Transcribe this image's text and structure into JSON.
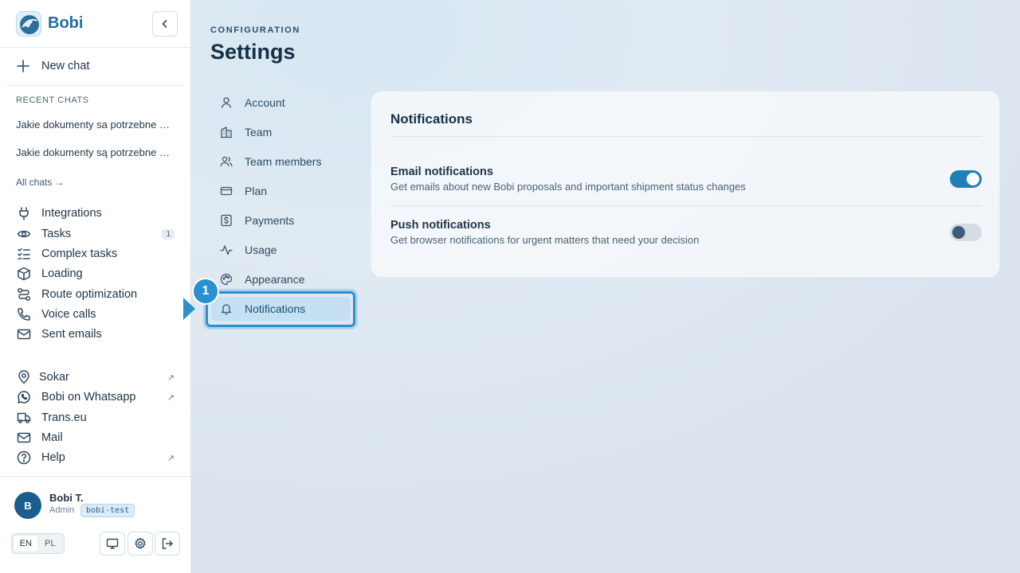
{
  "brand": {
    "name": "Bobi"
  },
  "sidebar": {
    "new_chat": "New chat",
    "recent_heading": "RECENT CHATS",
    "recent_chats": [
      "Jakie dokumenty sa potrzebne do przewozu",
      "Jakie dokumenty są potrzebne do przewozu"
    ],
    "all_chats": "All chats →",
    "nav": [
      {
        "label": "Integrations",
        "icon": "plug-icon"
      },
      {
        "label": "Tasks",
        "icon": "eye-icon",
        "badge": "1"
      },
      {
        "label": "Complex tasks",
        "icon": "checklist-icon"
      },
      {
        "label": "Loading",
        "icon": "box-icon"
      },
      {
        "label": "Route optimization",
        "icon": "route-icon"
      },
      {
        "label": "Voice calls",
        "icon": "phone-icon"
      },
      {
        "label": "Sent emails",
        "icon": "mail-icon"
      }
    ],
    "external": [
      {
        "label": "Sokar",
        "icon": "pin-icon",
        "ext": "↗"
      },
      {
        "label": "Bobi on Whatsapp",
        "icon": "whatsapp-icon",
        "ext": "↗"
      },
      {
        "label": "Trans.eu",
        "icon": "truck-icon"
      },
      {
        "label": "Mail",
        "icon": "mail-icon"
      },
      {
        "label": "Help",
        "icon": "help-icon",
        "ext": "↗"
      }
    ],
    "user": {
      "initial": "B",
      "name": "Bobi T.",
      "role": "Admin",
      "org": "bobi-test"
    },
    "languages": [
      "EN",
      "PL"
    ],
    "active_language": "EN"
  },
  "settings": {
    "kicker": "CONFIGURATION",
    "title": "Settings",
    "nav": [
      {
        "label": "Account",
        "icon": "user-icon"
      },
      {
        "label": "Team",
        "icon": "building-icon"
      },
      {
        "label": "Team members",
        "icon": "users-icon"
      },
      {
        "label": "Plan",
        "icon": "credit-card-icon"
      },
      {
        "label": "Payments",
        "icon": "dollar-icon"
      },
      {
        "label": "Usage",
        "icon": "activity-icon"
      },
      {
        "label": "Appearance",
        "icon": "palette-icon"
      },
      {
        "label": "Notifications",
        "icon": "bell-icon",
        "active": true
      }
    ],
    "step_marker": "1"
  },
  "notifications": {
    "title": "Notifications",
    "rows": [
      {
        "title": "Email notifications",
        "description": "Get emails about new Bobi proposals and important shipment status changes",
        "enabled": true
      },
      {
        "title": "Push notifications",
        "description": "Get browser notifications for urgent matters that need your decision",
        "enabled": false
      }
    ]
  },
  "colors": {
    "accent": "#1f7fb8",
    "highlight": "#2b8fd0",
    "brand": "#1f6fa5"
  }
}
